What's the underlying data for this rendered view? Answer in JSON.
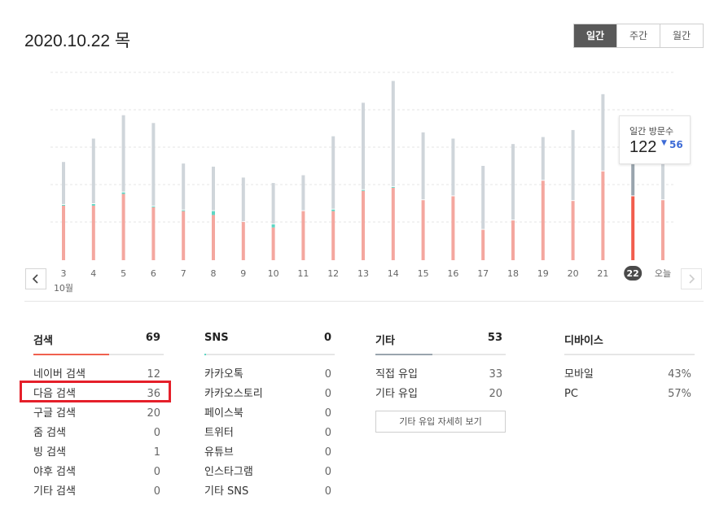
{
  "header": {
    "date": "2020.10.22 목"
  },
  "period_tabs": [
    {
      "label": "일간",
      "active": true
    },
    {
      "label": "주간",
      "active": false
    },
    {
      "label": "월간",
      "active": false
    }
  ],
  "colors": {
    "search": "#f4a79f",
    "search_selected": "#f25d4d",
    "sns": "#5dd6c4",
    "other": "#cfd5da",
    "other_selected": "#9aa5ae",
    "search_section_line": "#f0604f",
    "other_section_line": "#9aa5ae",
    "highlight": "#e5202a"
  },
  "chart_data": {
    "type": "bar",
    "stacked": true,
    "categories": [
      "3",
      "4",
      "5",
      "6",
      "7",
      "8",
      "9",
      "10",
      "11",
      "12",
      "13",
      "14",
      "15",
      "16",
      "17",
      "18",
      "19",
      "20",
      "21",
      "22",
      "오늘"
    ],
    "month_label": "10월",
    "selected": "22",
    "series": [
      {
        "key": "search",
        "values": [
          70,
          70,
          85,
          68,
          63,
          58,
          49,
          42,
          63,
          63,
          89,
          93,
          77,
          82,
          39,
          51,
          102,
          76,
          114,
          82,
          77
        ]
      },
      {
        "key": "sns",
        "values": [
          1,
          2,
          2,
          1,
          1,
          5,
          0,
          4,
          0,
          2,
          1,
          1,
          0,
          0,
          0,
          0,
          0,
          0,
          0,
          0,
          0
        ]
      },
      {
        "key": "other",
        "values": [
          54,
          83,
          98,
          106,
          59,
          56,
          56,
          52,
          45,
          93,
          111,
          135,
          86,
          73,
          81,
          97,
          55,
          90,
          98,
          40,
          50
        ]
      }
    ],
    "ylim": [
      0,
      240
    ],
    "grid": true
  },
  "tooltip": {
    "label": "일간 방문수",
    "value": "122",
    "change_arrow": "▼",
    "change": "56"
  },
  "sections": {
    "search": {
      "title": "검색",
      "total": "69",
      "share": 0.58,
      "items": [
        {
          "label": "네이버 검색",
          "value": "12"
        },
        {
          "label": "다음 검색",
          "value": "36"
        },
        {
          "label": "구글 검색",
          "value": "20"
        },
        {
          "label": "줌 검색",
          "value": "0"
        },
        {
          "label": "빙 검색",
          "value": "1"
        },
        {
          "label": "야후 검색",
          "value": "0"
        },
        {
          "label": "기타 검색",
          "value": "0"
        }
      ]
    },
    "sns": {
      "title": "SNS",
      "total": "0",
      "share": 0.01,
      "items": [
        {
          "label": "카카오톡",
          "value": "0"
        },
        {
          "label": "카카오스토리",
          "value": "0"
        },
        {
          "label": "페이스북",
          "value": "0"
        },
        {
          "label": "트위터",
          "value": "0"
        },
        {
          "label": "유튜브",
          "value": "0"
        },
        {
          "label": "인스타그램",
          "value": "0"
        },
        {
          "label": "기타 SNS",
          "value": "0"
        }
      ]
    },
    "other": {
      "title": "기타",
      "total": "53",
      "share": 0.44,
      "items": [
        {
          "label": "직접 유입",
          "value": "33"
        },
        {
          "label": "기타 유입",
          "value": "20"
        }
      ],
      "detail_button": "기타 유입 자세히 보기"
    },
    "device": {
      "title": "디바이스",
      "items": [
        {
          "label": "모바일",
          "value": "43%"
        },
        {
          "label": "PC",
          "value": "57%"
        }
      ]
    }
  }
}
